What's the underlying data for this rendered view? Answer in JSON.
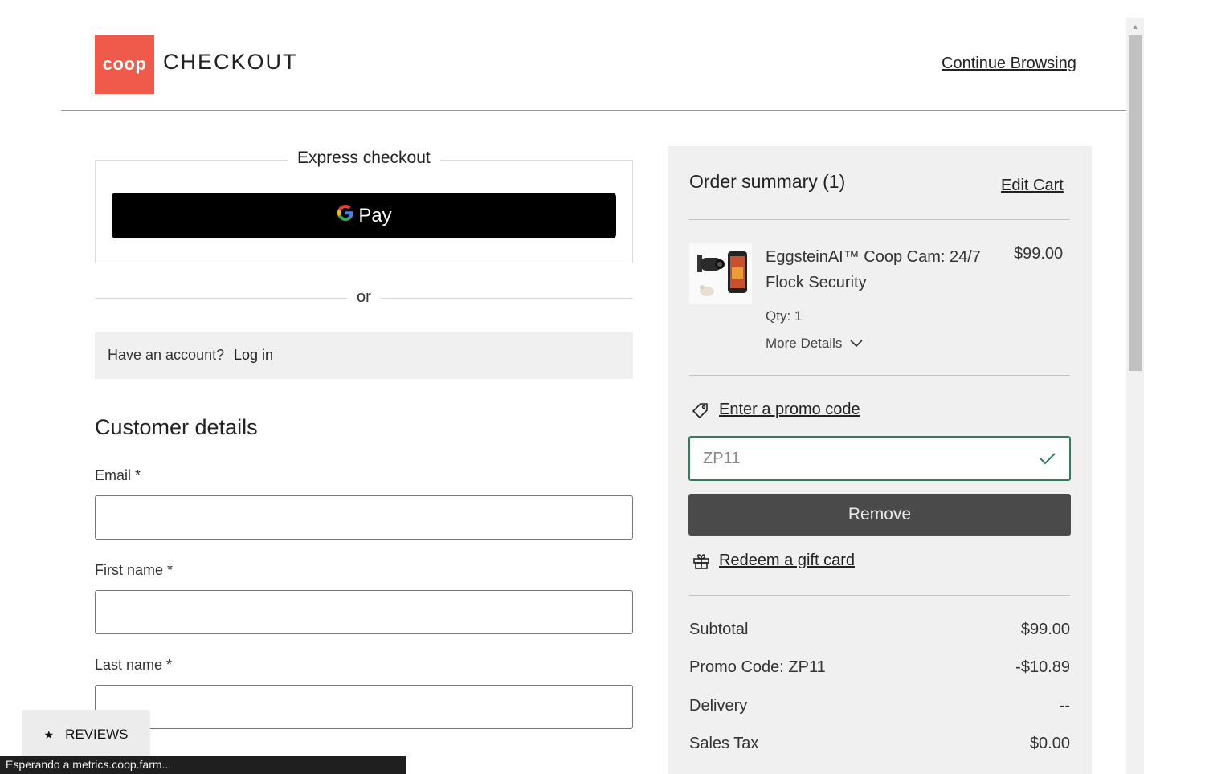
{
  "header": {
    "logo_text": "coop",
    "title": "CHECKOUT",
    "continue_label": "Continue Browsing"
  },
  "express": {
    "label": "Express checkout",
    "gpay_g": "G",
    "gpay_label": "Pay"
  },
  "divider": {
    "or": "or"
  },
  "login": {
    "question": "Have an account?",
    "link": "Log in"
  },
  "customer": {
    "heading": "Customer details",
    "email_label": "Email *",
    "first_name_label": "First name *",
    "last_name_label": "Last name *"
  },
  "summary": {
    "title": "Order summary (1)",
    "edit_cart": "Edit Cart",
    "item": {
      "name": "EggsteinAI™ Coop Cam: 24/7 Flock Security",
      "price": "$99.00",
      "qty": "Qty: 1",
      "more_details": "More Details"
    },
    "promo_link": "Enter a promo code",
    "promo_value": "ZP11",
    "remove_label": "Remove",
    "gift_link": "Redeem a gift card",
    "totals": [
      {
        "label": "Subtotal",
        "value": "$99.00"
      },
      {
        "label": "Promo Code: ZP11",
        "value": "-$10.89"
      },
      {
        "label": "Delivery",
        "value": "--"
      },
      {
        "label": "Sales Tax",
        "value": "$0.00"
      }
    ]
  },
  "widgets": {
    "reviews_label": "REVIEWS",
    "status_text": "Esperando a metrics.coop.farm..."
  },
  "colors": {
    "brand": "#f05a4a",
    "promo_valid": "#2e7d5b",
    "remove_button": "#4a4a4a"
  }
}
